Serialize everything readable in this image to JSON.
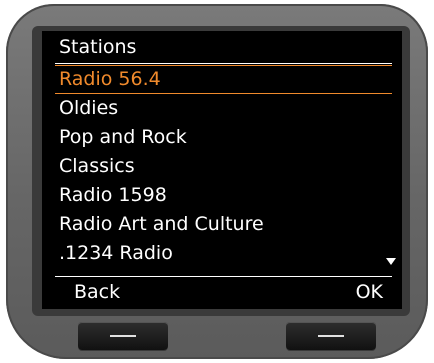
{
  "screen": {
    "title": "Stations",
    "stations": [
      {
        "label": "Radio 56.4",
        "selected": true
      },
      {
        "label": "Oldies",
        "selected": false
      },
      {
        "label": "Pop and Rock",
        "selected": false
      },
      {
        "label": "Classics",
        "selected": false
      },
      {
        "label": "Radio 1598",
        "selected": false
      },
      {
        "label": "Radio Art and Culture",
        "selected": false
      },
      {
        "label": ".1234 Radio",
        "selected": false
      }
    ],
    "scroll_indicator_icon": "triangle-down-icon",
    "softkeys": {
      "left_label": "Back",
      "right_label": "OK"
    }
  },
  "colors": {
    "screen_background": "#000000",
    "text": "#ffffff",
    "selection_accent": "#f08a2c",
    "device_body": "#6e6e6e"
  },
  "hardware_keys": {
    "left_icon": "dash-icon",
    "right_icon": "dash-icon"
  }
}
